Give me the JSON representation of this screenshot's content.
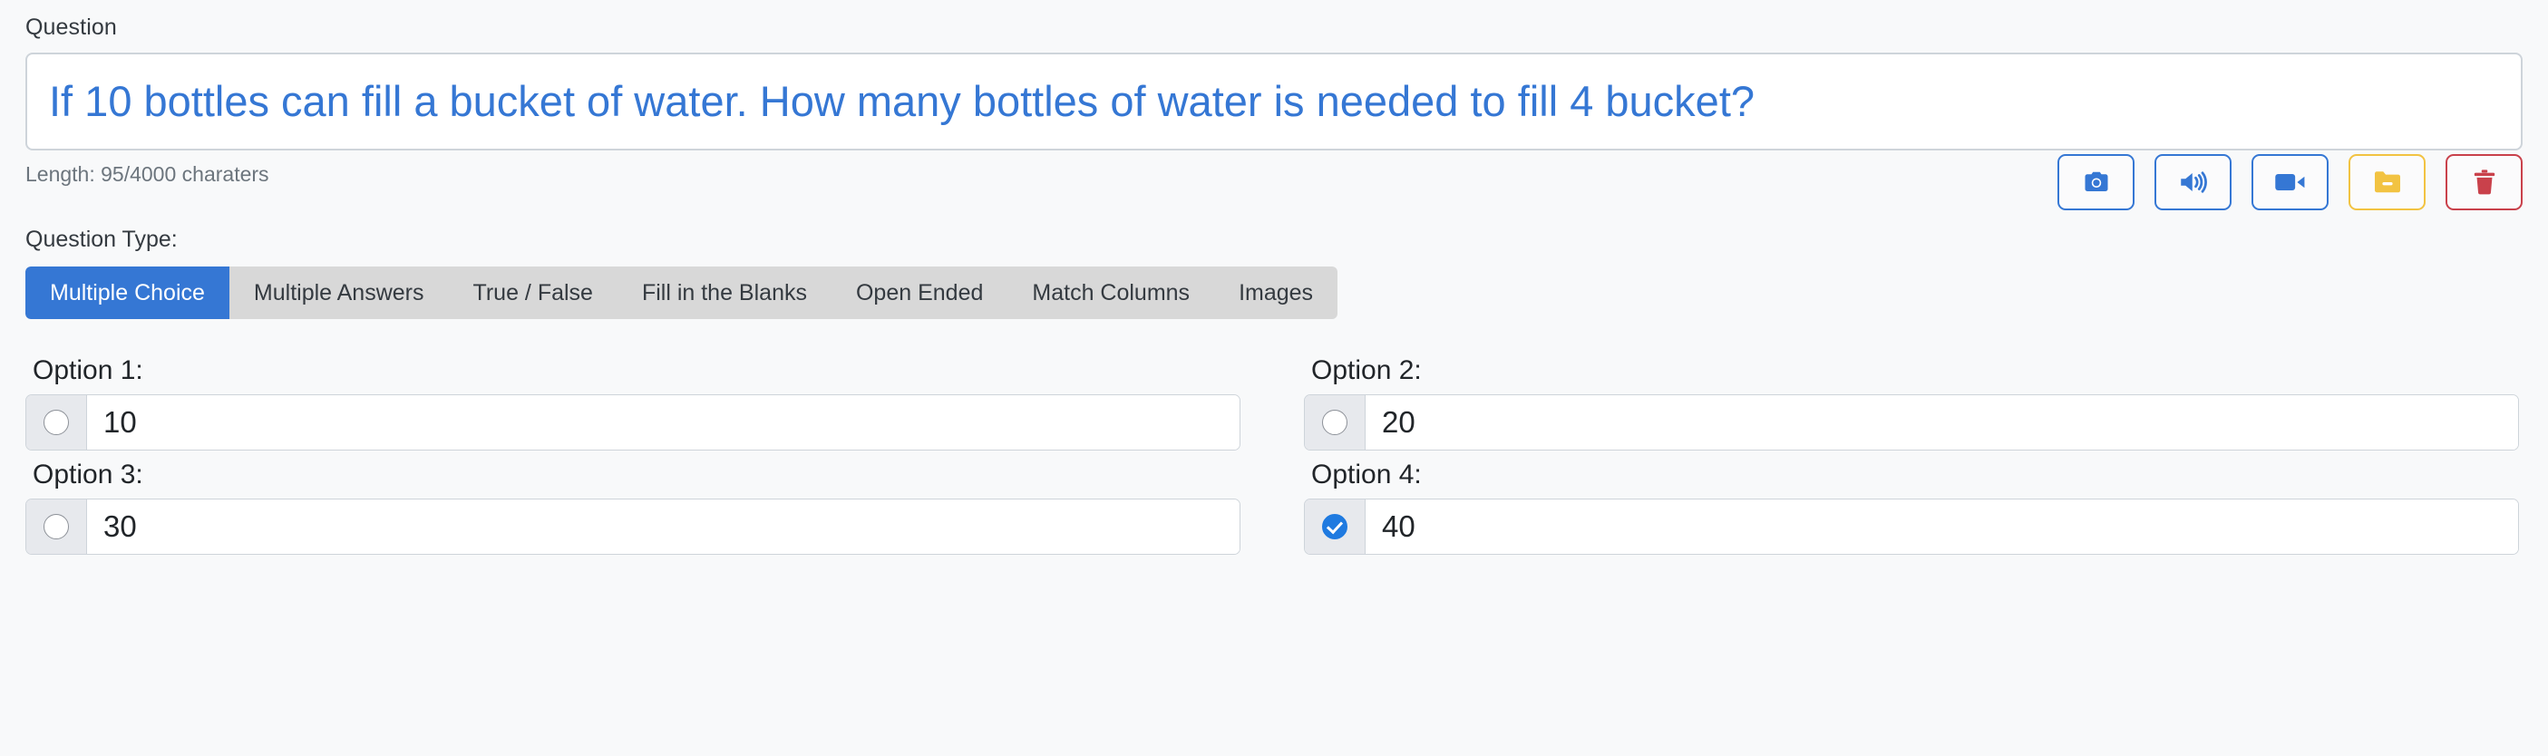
{
  "question": {
    "label": "Question",
    "text": "If 10 bottles can fill a bucket of water. How many bottles of water is needed to fill 4 bucket?",
    "placeholder": "",
    "length_text": "Length: 95/4000 charaters",
    "text_color": "#3577d4"
  },
  "toolbar": {
    "buttons": [
      {
        "name": "camera-button",
        "icon": "camera-icon",
        "color": "#3577d4",
        "variant": "blue"
      },
      {
        "name": "audio-button",
        "icon": "volume-up-icon",
        "color": "#3577d4",
        "variant": "blue"
      },
      {
        "name": "video-button",
        "icon": "video-camera-icon",
        "color": "#3577d4",
        "variant": "blue"
      },
      {
        "name": "folder-button",
        "icon": "folder-minus-icon",
        "color": "#f2c342",
        "variant": "yellow"
      },
      {
        "name": "delete-button",
        "icon": "trash-icon",
        "color": "#c9414b",
        "variant": "red"
      }
    ]
  },
  "question_type": {
    "label": "Question Type:",
    "active_index": 0,
    "tabs": [
      {
        "label": "Multiple Choice"
      },
      {
        "label": "Multiple Answers"
      },
      {
        "label": "True / False"
      },
      {
        "label": "Fill in the Blanks"
      },
      {
        "label": "Open Ended"
      },
      {
        "label": "Match Columns"
      },
      {
        "label": "Images"
      }
    ]
  },
  "options": [
    {
      "label": "Option 1:",
      "value": "10",
      "selected": false
    },
    {
      "label": "Option 2:",
      "value": "20",
      "selected": false
    },
    {
      "label": "Option 3:",
      "value": "30",
      "selected": false
    },
    {
      "label": "Option 4:",
      "value": "40",
      "selected": true
    }
  ],
  "colors": {
    "accent_blue": "#3577d4",
    "radio_checked": "#1f7ae0",
    "tab_bar_bg": "#d8d8d8",
    "page_bg": "#f8f9fa",
    "border": "#ced4da"
  }
}
